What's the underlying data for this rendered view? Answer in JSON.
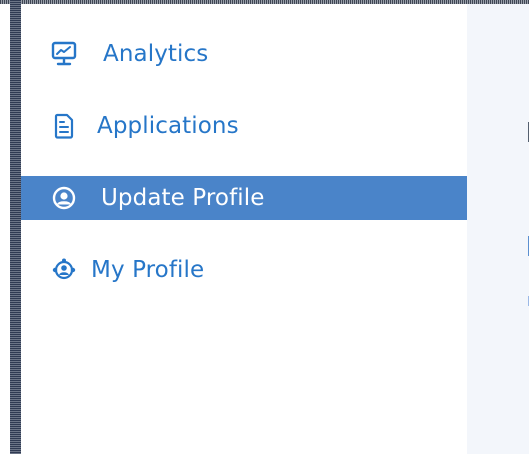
{
  "sidebar": {
    "items": [
      {
        "label": "Analytics",
        "icon": "chart-monitor-icon",
        "active": false
      },
      {
        "label": "Applications",
        "icon": "document-icon",
        "active": false
      },
      {
        "label": "Update Profile",
        "icon": "user-circle-icon",
        "active": true
      },
      {
        "label": "My Profile",
        "icon": "team-icon",
        "active": false
      }
    ]
  },
  "colors": {
    "accent": "#2676c8",
    "active_background": "#4a84c9",
    "content_background": "#f3f6fb",
    "active_text": "#ffffff"
  }
}
